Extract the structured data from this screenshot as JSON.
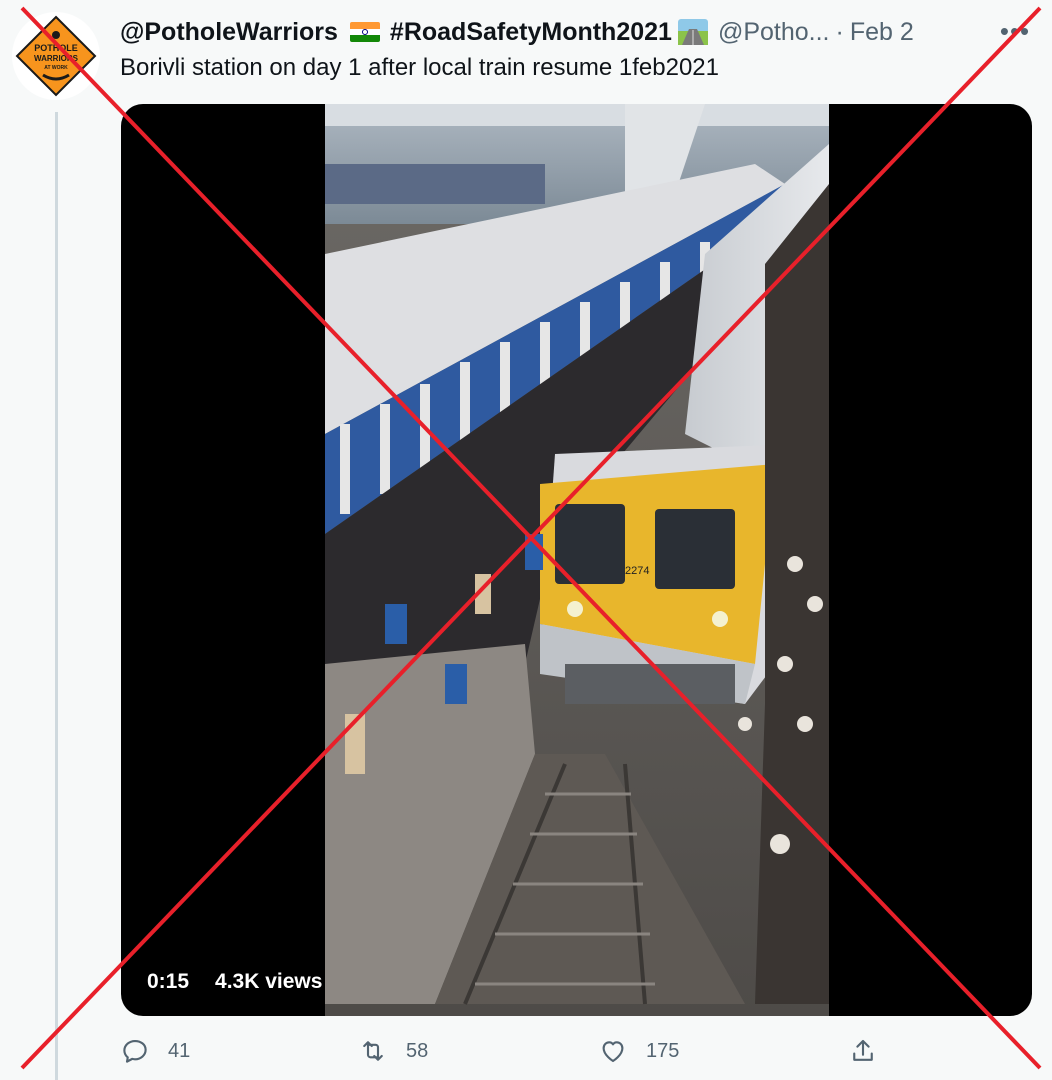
{
  "tweet": {
    "display_name": "@PotholeWarriors",
    "hashtag": "#RoadSafetyMonth2021",
    "handle": "@Potho...",
    "separator": "·",
    "date": "Feb 2",
    "text": "Borivli station on day 1 after local train resume 1feb2021",
    "avatar_logo_text": [
      "POTHOLE",
      "WARRIORS",
      "AT WORK"
    ]
  },
  "media": {
    "type": "video",
    "duration": "0:15",
    "views": "4.3K views",
    "train_number": "2274"
  },
  "actions": {
    "reply_count": "41",
    "retweet_count": "58",
    "like_count": "175"
  },
  "icons": [
    "more-icon",
    "reply-icon",
    "retweet-icon",
    "like-icon",
    "share-icon",
    "india-flag-icon",
    "railway-track-icon"
  ],
  "colors": {
    "cross": "#e8202a",
    "text_primary": "#0f1419",
    "text_secondary": "#536471",
    "logo_orange": "#f7941d",
    "train_yellow": "#e8b62c"
  }
}
